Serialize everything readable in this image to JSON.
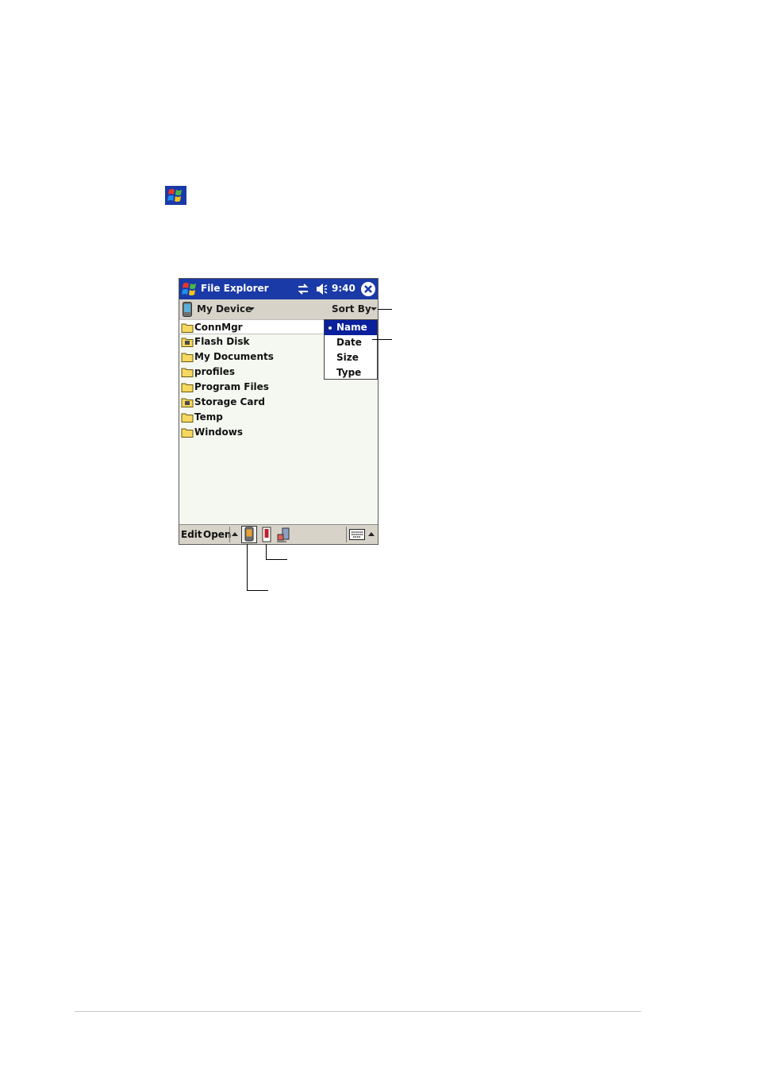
{
  "window": {
    "title": "File Explorer",
    "time": "9:40"
  },
  "navbar": {
    "location": "My Device",
    "sort_label": "Sort By"
  },
  "files": [
    {
      "name": "ConnMgr",
      "icon": "folder-icon"
    },
    {
      "name": "Flash Disk",
      "icon": "storage-folder-icon"
    },
    {
      "name": "My Documents",
      "icon": "folder-icon"
    },
    {
      "name": "profiles",
      "icon": "folder-icon"
    },
    {
      "name": "Program Files",
      "icon": "folder-icon"
    },
    {
      "name": "Storage Card",
      "icon": "storage-folder-icon"
    },
    {
      "name": "Temp",
      "icon": "folder-icon"
    },
    {
      "name": "Windows",
      "icon": "folder-icon"
    }
  ],
  "sort_menu": {
    "items": [
      "Name",
      "Date",
      "Size",
      "Type"
    ],
    "selected": "Name"
  },
  "command_bar": {
    "edit_label": "Edit",
    "open_label": "Open"
  },
  "colors": {
    "titlebar": "#1a3aa8",
    "menu_highlight": "#0a1f9c",
    "bar_gray": "#d8d3c9"
  }
}
